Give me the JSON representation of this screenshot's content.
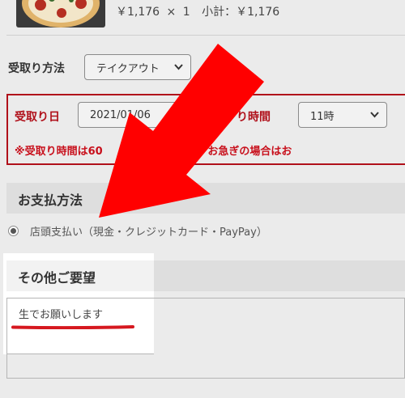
{
  "cart": {
    "price": "￥1,176",
    "times": "×",
    "qty": "1",
    "subtotal_label": "小計：",
    "subtotal": "￥1,176"
  },
  "pickup": {
    "method_label": "受取り方法",
    "method_value": "テイクアウト",
    "date_label": "受取り日",
    "date_value": "2021/01/06",
    "time_label": "り時間",
    "time_value": "11時",
    "note": "※受取り時間は60　　　　てください。お急ぎの場合はお"
  },
  "payment": {
    "heading": "お支払方法",
    "option_label": "店頭支払い（現金・クレジットカード・PayPay）"
  },
  "other": {
    "heading": "その他ご要望",
    "request_text": "生でお願いします"
  },
  "colors": {
    "accent_red": "#b0101a",
    "arrow_red": "#ff0000"
  },
  "icons": [
    "pizza-thumbnail",
    "chevron-down-icon",
    "radio-selected-icon",
    "annotation-arrow",
    "annotation-underline"
  ]
}
